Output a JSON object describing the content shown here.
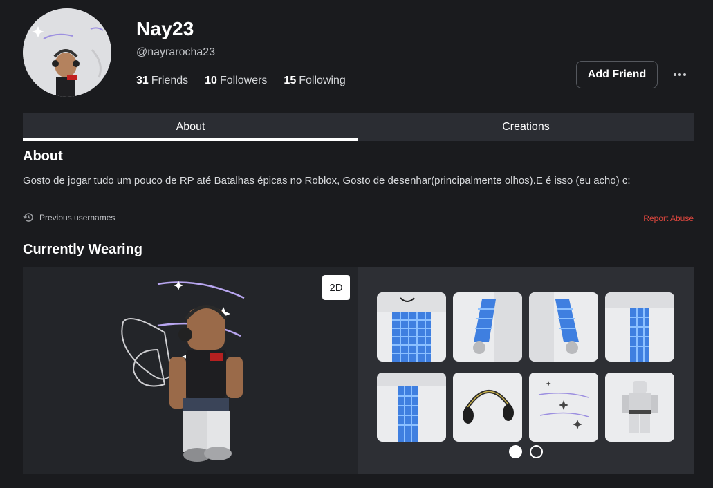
{
  "profile": {
    "display_name": "Nay23",
    "username": "@nayrarocha23",
    "friends_count": "31",
    "friends_label": "Friends",
    "followers_count": "10",
    "followers_label": "Followers",
    "following_count": "15",
    "following_label": "Following",
    "add_friend_label": "Add Friend"
  },
  "tabs": [
    {
      "label": "About",
      "active": true
    },
    {
      "label": "Creations",
      "active": false
    }
  ],
  "about": {
    "title": "About",
    "description": "Gosto de jogar tudo um pouco de RP até Batalhas épicas no Roblox, Gosto de desenhar(principalmente olhos).E é isso (eu acho) c:",
    "previous_usernames_label": "Previous usernames",
    "report_abuse_label": "Report Abuse"
  },
  "wearing": {
    "title": "Currently Wearing",
    "view_toggle_label": "2D",
    "items": [
      {
        "name": "blue-checkered-shirt-torso"
      },
      {
        "name": "blue-checkered-left-arm"
      },
      {
        "name": "blue-checkered-right-arm"
      },
      {
        "name": "blue-checkered-left-leg"
      },
      {
        "name": "blue-checkered-right-leg"
      },
      {
        "name": "black-headphones"
      },
      {
        "name": "sparkle-trails"
      },
      {
        "name": "white-body-outfit"
      }
    ],
    "pages": 2,
    "current_page": 1
  },
  "colors": {
    "background": "#1a1b1e",
    "tab_bar": "#2b2d33",
    "report_abuse": "#e0473e"
  }
}
